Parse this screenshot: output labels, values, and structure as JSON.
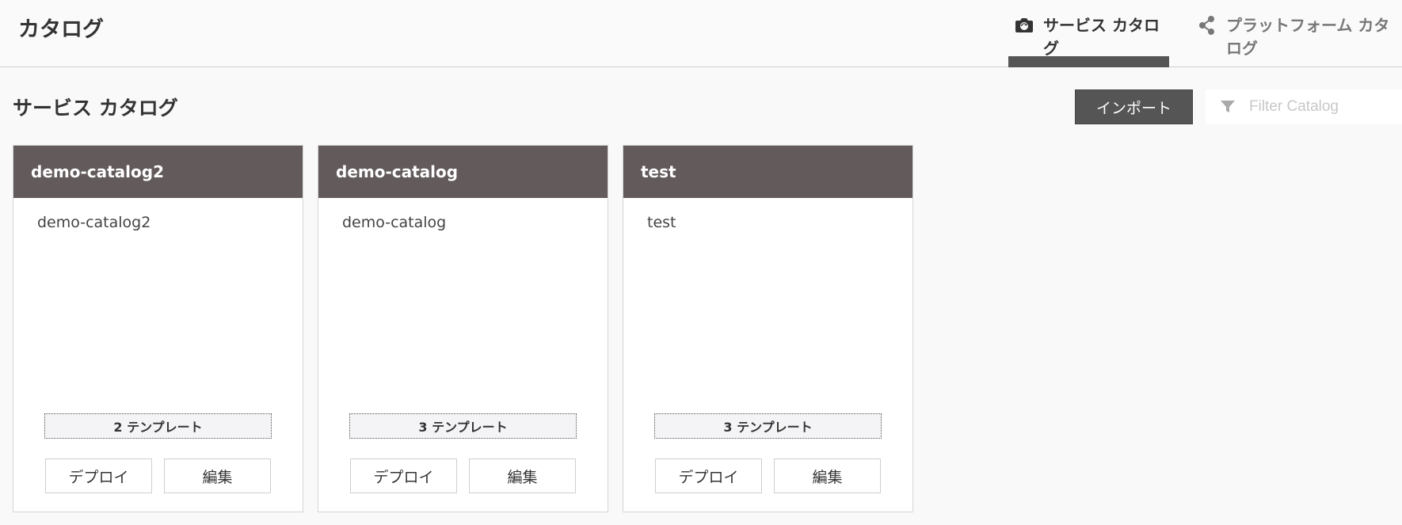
{
  "header": {
    "title": "カタログ",
    "tabs": [
      {
        "label": "サービス カタログ",
        "icon": "camera-icon",
        "active": true
      },
      {
        "label": "プラットフォーム カタログ",
        "icon": "share-icon",
        "active": false
      }
    ]
  },
  "main": {
    "section_title": "サービス カタログ",
    "import_label": "インポート",
    "filter_placeholder": "Filter Catalog",
    "filter_value": ""
  },
  "cards": [
    {
      "name": "demo-catalog2",
      "description": "demo-catalog2",
      "templates": "2 テンプレート",
      "deploy_label": "デプロイ",
      "edit_label": "編集"
    },
    {
      "name": "demo-catalog",
      "description": "demo-catalog",
      "templates": "3 テンプレート",
      "deploy_label": "デプロイ",
      "edit_label": "編集"
    },
    {
      "name": "test",
      "description": "test",
      "templates": "3 テンプレート",
      "deploy_label": "デプロイ",
      "edit_label": "編集"
    }
  ],
  "colors": {
    "card_header_bg": "#625a5b",
    "button_dark": "#555555",
    "active_tab_underline": "#555555",
    "page_bg": "#f9f9f9"
  }
}
